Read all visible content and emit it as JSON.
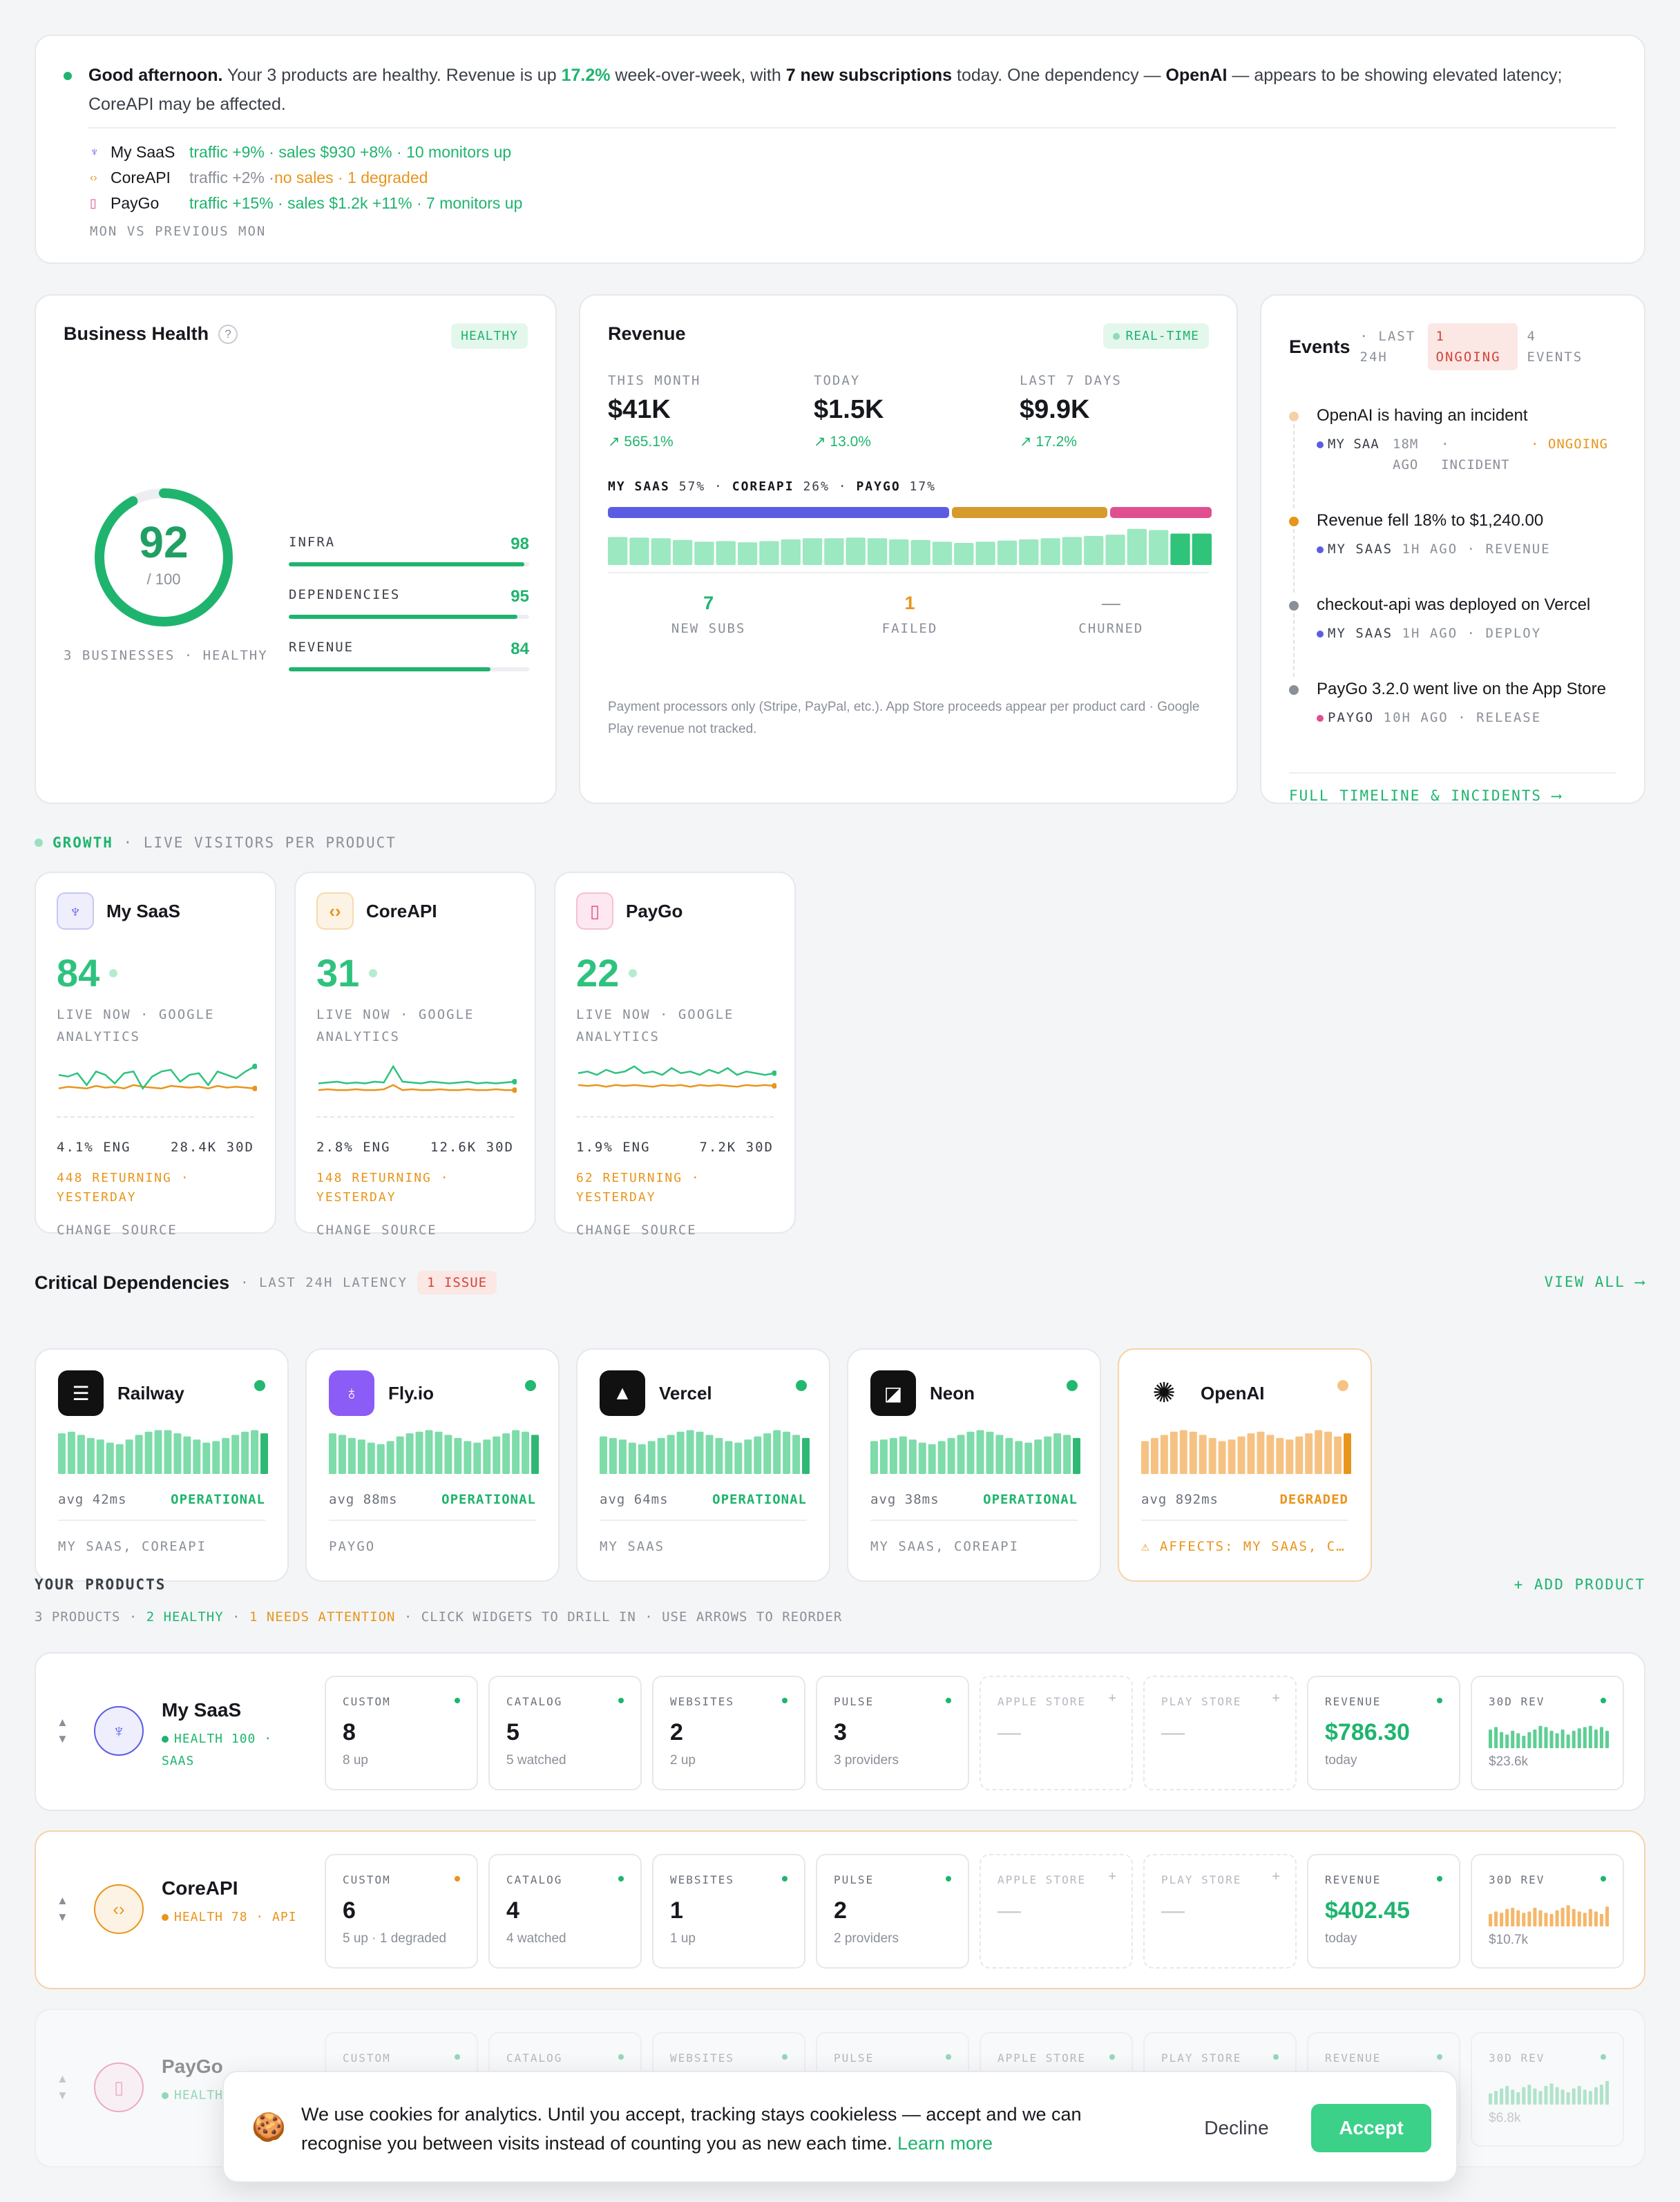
{
  "summary": {
    "greeting": "Good afternoon.",
    "t1": " Your 3 products are healthy. Revenue is up ",
    "pct": "17.2%",
    "t2": " week-over-week, with ",
    "subs": "7 new subscriptions",
    "t3": " today. One dependency — ",
    "dep": "OpenAI",
    "t4": " — appears to be showing elevated latency; CoreAPI may be affected.",
    "products": [
      {
        "name": "My SaaS",
        "icon": "rocket-icon",
        "glyph": "♆",
        "color": "#5b5ce2",
        "detail": "traffic +9% · sales $930 +8% · 10 monitors up",
        "detail_color": "#1fb46e"
      },
      {
        "name": "CoreAPI",
        "icon": "code-icon",
        "glyph": "‹›",
        "color": "#e8951c",
        "detail_a": "traffic +2% · ",
        "detail_b": "no sales · 1 degraded"
      },
      {
        "name": "PayGo",
        "icon": "phone-icon",
        "glyph": "▯",
        "color": "#e0508f",
        "detail": "traffic +15% · sales $1.2k +11% · 7 monitors up",
        "detail_color": "#1fb46e"
      }
    ],
    "footnote": "MON VS PREVIOUS MON"
  },
  "health": {
    "title": "Business Health",
    "help": "?",
    "badge": "HEALTHY",
    "score": "92",
    "score_value": 92,
    "of": "/ 100",
    "footer": "3 BUSINESSES · HEALTHY",
    "metrics": [
      {
        "label": "INFRA",
        "value": "98",
        "pct": 98
      },
      {
        "label": "DEPENDENCIES",
        "value": "95",
        "pct": 95
      },
      {
        "label": "REVENUE",
        "value": "84",
        "pct": 84
      }
    ]
  },
  "revenue": {
    "title": "Revenue",
    "badge": "REAL-TIME",
    "stats": [
      {
        "label": "THIS MONTH",
        "value": "$41K",
        "change": "↗ 565.1%"
      },
      {
        "label": "TODAY",
        "value": "$1.5K",
        "change": "↗ 13.0%"
      },
      {
        "label": "LAST 7 DAYS",
        "value": "$9.9K",
        "change": "↗ 17.2%"
      }
    ],
    "split": [
      {
        "name": "MY SAAS",
        "pct": "57%",
        "share": 57,
        "color": "#5b5ce2"
      },
      {
        "name": "COREAPI",
        "pct": "26%",
        "share": 26,
        "color": "#d69a2d"
      },
      {
        "name": "PAYGO",
        "pct": "17%",
        "share": 17,
        "color": "#e0508f"
      }
    ],
    "daily": [
      48,
      47,
      46,
      43,
      40,
      41,
      39,
      41,
      44,
      46,
      46,
      47,
      46,
      44,
      43,
      40,
      38,
      40,
      42,
      44,
      46,
      48,
      50,
      52,
      62,
      60,
      54,
      54
    ],
    "kpis": [
      {
        "value": "7",
        "label": "NEW SUBS",
        "color": "#1fb46e"
      },
      {
        "value": "1",
        "label": "FAILED",
        "color": "#e8951c"
      },
      {
        "value": "—",
        "label": "CHURNED",
        "color": "#8a8f98"
      }
    ],
    "note": "Payment processors only (Stripe, PayPal, etc.). App Store proceeds appear per product card · Google Play revenue not tracked."
  },
  "events": {
    "title": "Events",
    "window": "· LAST 24H",
    "ongoing": "1 ONGOING",
    "count": "4 EVENTS",
    "items": [
      {
        "title": "OpenAI is having an incident",
        "dot": "#f6d0a6",
        "product": "MY SAA",
        "pcolor": "#5b5ce2",
        "time": "18M AGO",
        "kind": "· INCIDENT",
        "extra": "· ONGOING"
      },
      {
        "title": "Revenue fell 18% to $1,240.00",
        "dot": "#e8951c",
        "product": "MY SAAS",
        "pcolor": "#5b5ce2",
        "time": "1H AGO",
        "kind": "· REVENUE"
      },
      {
        "title": "checkout-api was deployed on Vercel",
        "dot": "#8a8f98",
        "product": "MY SAAS",
        "pcolor": "#5b5ce2",
        "time": "1H AGO",
        "kind": "· DEPLOY"
      },
      {
        "title": "PayGo 3.2.0 went live on the App Store",
        "dot": "#8a8f98",
        "product": "PAYGO",
        "pcolor": "#e0508f",
        "time": "10H AGO",
        "kind": "· RELEASE"
      }
    ],
    "link": "FULL TIMELINE & INCIDENTS ⟶"
  },
  "growth": {
    "title": "GROWTH",
    "subtitle": "· LIVE VISITORS PER PRODUCT",
    "cards": [
      {
        "name": "My SaaS",
        "icon": "rocket-icon",
        "glyph": "♆",
        "color": "#5b5ce2",
        "bg": "#eeeefd",
        "live": "84",
        "source": "LIVE NOW · GOOGLE ANALYTICS",
        "eng": "4.1% ENG",
        "views": "28.4K 30D",
        "returning": "448 RETURNING · YESTERDAY",
        "change": "CHANGE SOURCE",
        "now": [
          30,
          28,
          32,
          18,
          34,
          30,
          20,
          32,
          34,
          14,
          28,
          34,
          36,
          22,
          30,
          32,
          18,
          34,
          30,
          26,
          34,
          40
        ],
        "prev": [
          14,
          16,
          15,
          14,
          17,
          15,
          16,
          14,
          18,
          16,
          15,
          14,
          17,
          16,
          15,
          16,
          14,
          17,
          15,
          16,
          15,
          14
        ]
      },
      {
        "name": "CoreAPI",
        "icon": "code-icon",
        "glyph": "‹›",
        "color": "#e8951c",
        "bg": "#fdf3e4",
        "live": "31",
        "source": "LIVE NOW · GOOGLE ANALYTICS",
        "eng": "2.8% ENG",
        "views": "12.6K 30D",
        "returning": "148 RETURNING · YESTERDAY",
        "change": "CHANGE SOURCE",
        "now": [
          20,
          21,
          22,
          20,
          21,
          20,
          22,
          21,
          40,
          22,
          21,
          20,
          22,
          21,
          20,
          21,
          22,
          20,
          21,
          20,
          21,
          22
        ],
        "prev": [
          12,
          13,
          12,
          12,
          13,
          12,
          12,
          13,
          18,
          12,
          13,
          12,
          12,
          13,
          12,
          12,
          13,
          12,
          12,
          13,
          12,
          12
        ]
      },
      {
        "name": "PayGo",
        "icon": "phone-icon",
        "glyph": "▯",
        "color": "#e0508f",
        "bg": "#fde8f1",
        "live": "22",
        "source": "LIVE NOW · GOOGLE ANALYTICS",
        "eng": "1.9% ENG",
        "views": "7.2K 30D",
        "returning": "62 RETURNING · YESTERDAY",
        "change": "CHANGE SOURCE",
        "now": [
          32,
          34,
          30,
          36,
          32,
          34,
          40,
          32,
          34,
          30,
          38,
          32,
          34,
          30,
          36,
          32,
          38,
          30,
          34,
          32,
          30,
          32
        ],
        "prev": [
          18,
          17,
          18,
          16,
          18,
          17,
          18,
          17,
          16,
          18,
          17,
          18,
          16,
          18,
          17,
          18,
          17,
          16,
          18,
          17,
          18,
          17
        ]
      }
    ]
  },
  "deps": {
    "title": "Critical Dependencies",
    "subtitle": "· LAST 24H LATENCY",
    "issues": "1 ISSUE",
    "view_all": "VIEW ALL ⟶",
    "cards": [
      {
        "name": "Railway",
        "icon": "railway-icon",
        "glyph": "☰",
        "bg": "#111",
        "avg": "avg 42ms",
        "status": "OPERATIONAL",
        "scolor": "#1fb46e",
        "bar": "#7ddca9",
        "last": "#2fb874",
        "uses": "MY SAAS, COREAPI",
        "bars": [
          52,
          54,
          50,
          46,
          44,
          40,
          38,
          44,
          50,
          54,
          56,
          56,
          52,
          48,
          44,
          40,
          42,
          46,
          50,
          54,
          56,
          52
        ]
      },
      {
        "name": "Fly.io",
        "icon": "balloon-icon",
        "glyph": "♁",
        "bg": "#8b5cf6",
        "avg": "avg 88ms",
        "status": "OPERATIONAL",
        "scolor": "#1fb46e",
        "bar": "#7ddca9",
        "last": "#2fb874",
        "uses": "PAYGO",
        "bars": [
          52,
          50,
          46,
          44,
          40,
          38,
          42,
          48,
          52,
          54,
          56,
          54,
          50,
          46,
          42,
          40,
          44,
          48,
          52,
          56,
          54,
          50
        ]
      },
      {
        "name": "Vercel",
        "icon": "triangle-icon",
        "glyph": "▲",
        "bg": "#111",
        "avg": "avg 64ms",
        "status": "OPERATIONAL",
        "scolor": "#1fb46e",
        "bar": "#7ddca9",
        "last": "#2fb874",
        "uses": "MY SAAS",
        "bars": [
          48,
          46,
          44,
          40,
          38,
          42,
          46,
          50,
          54,
          56,
          54,
          50,
          46,
          42,
          40,
          44,
          48,
          52,
          56,
          54,
          50,
          46
        ]
      },
      {
        "name": "Neon",
        "icon": "neon-icon",
        "glyph": "◪",
        "bg": "#111",
        "avg": "avg 38ms",
        "status": "OPERATIONAL",
        "scolor": "#1fb46e",
        "bar": "#7ddca9",
        "last": "#2fb874",
        "uses": "MY SAAS, COREAPI",
        "bars": [
          42,
          44,
          46,
          48,
          44,
          40,
          38,
          42,
          46,
          50,
          54,
          56,
          54,
          50,
          46,
          42,
          40,
          44,
          48,
          52,
          50,
          46
        ]
      },
      {
        "name": "OpenAI",
        "icon": "openai-icon",
        "glyph": "✺",
        "bg": "#fff",
        "avg": "avg 892ms",
        "status": "DEGRADED",
        "scolor": "#e8951c",
        "bar": "#f6c283",
        "last": "#e8951c",
        "uses": "⚠ AFFECTS: MY SAAS, COREAPI",
        "bars": [
          42,
          46,
          50,
          54,
          56,
          54,
          50,
          46,
          42,
          44,
          48,
          52,
          54,
          50,
          46,
          44,
          48,
          52,
          56,
          54,
          48,
          52
        ]
      }
    ]
  },
  "products": {
    "title": "YOUR PRODUCTS",
    "add": "+ ADD PRODUCT",
    "summary_a": "3 PRODUCTS · ",
    "summary_b": "2 HEALTHY",
    "summary_c": " · ",
    "summary_d": "1 NEEDS ATTENTION",
    "summary_e": " · CLICK WIDGETS TO DRILL IN · USE ARROWS TO REORDER",
    "rows": [
      {
        "name": "My SaaS",
        "glyph": "♆",
        "color": "#5b5ce2",
        "bg": "#eeeefd",
        "sub": "HEALTH 100 · SAAS",
        "subcolor": "#1fb46e",
        "border": "#e6e8ec",
        "faded": false,
        "widgets": [
          {
            "label": "CUSTOM",
            "value": "8",
            "sub": "8 up",
            "dot": "#1fb46e"
          },
          {
            "label": "CATALOG",
            "value": "5",
            "sub": "5 watched",
            "dot": "#1fb46e"
          },
          {
            "label": "WEBSITES",
            "value": "2",
            "sub": "2 up",
            "dot": "#1fb46e"
          },
          {
            "label": "PULSE",
            "value": "3",
            "sub": "3 providers",
            "dot": "#1fb46e"
          },
          {
            "label": "APPLE STORE",
            "value": "—",
            "empty": true
          },
          {
            "label": "PLAY STORE",
            "value": "—",
            "empty": true
          },
          {
            "label": "REVENUE",
            "value": "$786.30",
            "sub": "today",
            "dot": "#1fb46e",
            "money": true
          },
          {
            "label": "30D REV",
            "sub": "$23.6k",
            "dot": "#1fb46e",
            "spark": true,
            "sc": "#5fce94",
            "bars": [
              30,
              34,
              26,
              22,
              28,
              24,
              20,
              26,
              30,
              36,
              34,
              28,
              24,
              30,
              22,
              28,
              32,
              34,
              36,
              30,
              34,
              28
            ]
          }
        ]
      },
      {
        "name": "CoreAPI",
        "glyph": "‹›",
        "color": "#e8951c",
        "bg": "#fdf3e4",
        "sub": "HEALTH 78 · API",
        "subcolor": "#e8951c",
        "border": "#f6d3a8",
        "faded": false,
        "widgets": [
          {
            "label": "CUSTOM",
            "value": "6",
            "sub": "5 up · 1 degraded",
            "dot": "#e8951c"
          },
          {
            "label": "CATALOG",
            "value": "4",
            "sub": "4 watched",
            "dot": "#1fb46e"
          },
          {
            "label": "WEBSITES",
            "value": "1",
            "sub": "1 up",
            "dot": "#1fb46e"
          },
          {
            "label": "PULSE",
            "value": "2",
            "sub": "2 providers",
            "dot": "#1fb46e"
          },
          {
            "label": "APPLE STORE",
            "value": "—",
            "empty": true
          },
          {
            "label": "PLAY STORE",
            "value": "—",
            "empty": true
          },
          {
            "label": "REVENUE",
            "value": "$402.45",
            "sub": "today",
            "dot": "#1fb46e",
            "money": true
          },
          {
            "label": "30D REV",
            "sub": "$10.7k",
            "dot": "#1fb46e",
            "spark": true,
            "sc": "#f4b76a",
            "bars": [
              20,
              24,
              22,
              28,
              30,
              26,
              22,
              24,
              30,
              26,
              22,
              20,
              26,
              30,
              34,
              28,
              24,
              22,
              28,
              24,
              20,
              32
            ]
          }
        ]
      },
      {
        "name": "PayGo",
        "glyph": "▯",
        "color": "#e0508f",
        "bg": "#fde8f1",
        "sub": "HEALTH · MOBILE",
        "subcolor": "#1fb46e",
        "border": "#e6e8ec",
        "faded": true,
        "widgets": [
          {
            "label": "CUSTOM",
            "dot": "#1fb46e"
          },
          {
            "label": "CATALOG",
            "dot": "#1fb46e"
          },
          {
            "label": "WEBSITES",
            "dot": "#1fb46e"
          },
          {
            "label": "PULSE",
            "dot": "#1fb46e"
          },
          {
            "label": "APPLE STORE",
            "dot": "#1fb46e"
          },
          {
            "label": "PLAY STORE",
            "dot": "#1fb46e"
          },
          {
            "label": "REVENUE",
            "dot": "#1fb46e"
          },
          {
            "label": "30D REV",
            "sub": "$6.8k",
            "dot": "#1fb46e",
            "spark": true,
            "sc": "#5fce94",
            "bars": [
              18,
              22,
              26,
              30,
              24,
              20,
              28,
              32,
              26,
              22,
              30,
              34,
              28,
              24,
              20,
              26,
              30,
              24,
              22,
              28,
              32,
              38
            ]
          }
        ]
      }
    ]
  },
  "cookie": {
    "icon": "cookie-icon",
    "text": "We use cookies for analytics. Until you accept, tracking stays cookieless — accept and we can recognise you between visits instead of counting you as new each time. ",
    "learn": "Learn more",
    "decline": "Decline",
    "accept": "Accept"
  }
}
